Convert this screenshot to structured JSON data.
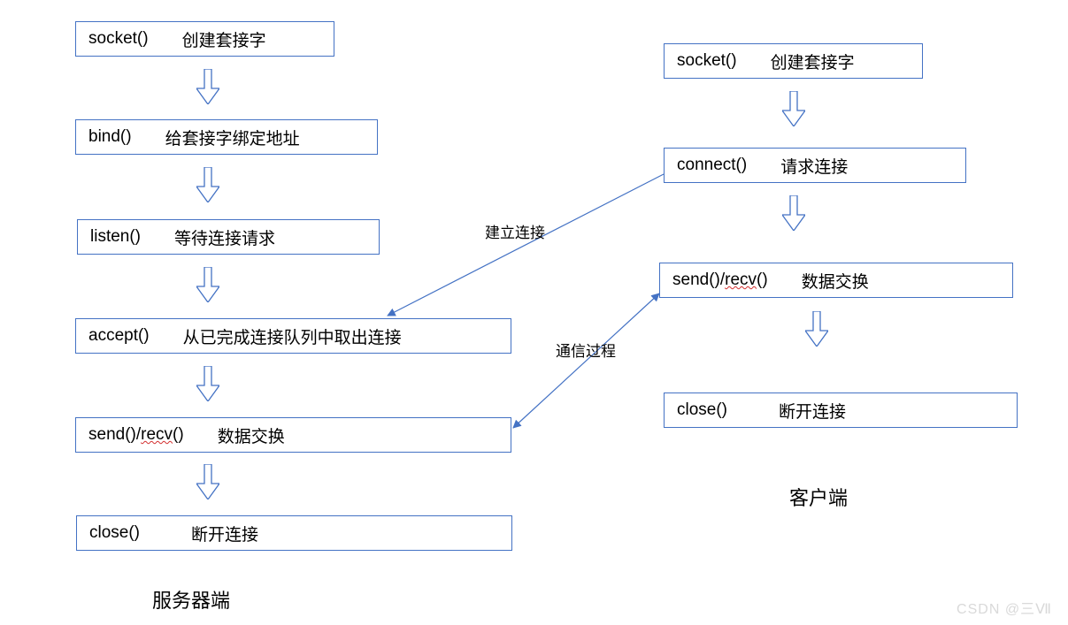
{
  "server": {
    "label": "服务器端",
    "steps": [
      {
        "fn": "socket()",
        "desc": "创建套接字"
      },
      {
        "fn": "bind()",
        "desc": "给套接字绑定地址"
      },
      {
        "fn": "listen()",
        "desc": "等待连接请求"
      },
      {
        "fn": "accept()",
        "desc": "从已完成连接队列中取出连接"
      },
      {
        "fn": "send()/recv()",
        "desc": "数据交换",
        "recv_underline": true
      },
      {
        "fn": "close()",
        "desc": "断开连接"
      }
    ]
  },
  "client": {
    "label": "客户端",
    "steps": [
      {
        "fn": "socket()",
        "desc": "创建套接字"
      },
      {
        "fn": "connect()",
        "desc": "请求连接"
      },
      {
        "fn": "send()/recv()",
        "desc": "数据交换",
        "recv_underline": true
      },
      {
        "fn": "close()",
        "desc": "断开连接"
      }
    ]
  },
  "edges": {
    "establish": "建立连接",
    "communicate": "通信过程"
  },
  "watermark": "CSDN @三Ⅶ",
  "colors": {
    "border": "#4472C4",
    "arrow_stroke": "#4472C4",
    "edge_stroke": "#4472C4"
  }
}
